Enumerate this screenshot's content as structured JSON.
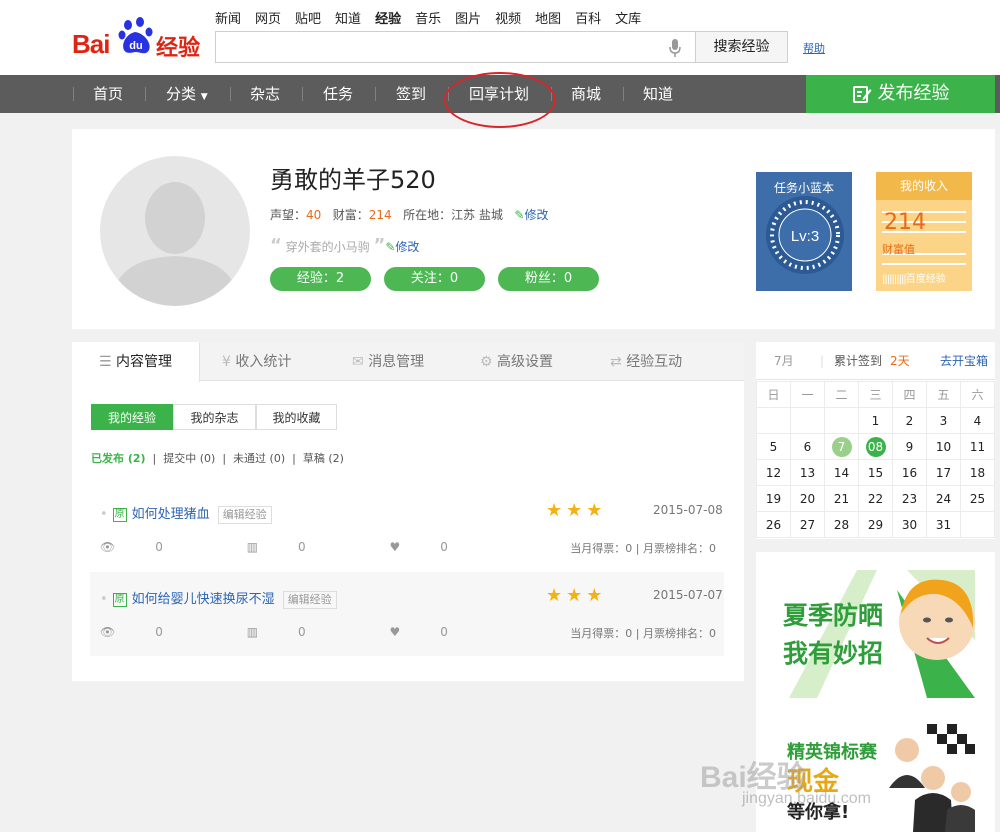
{
  "header": {
    "logo_text": "Bai",
    "logo_du": "du",
    "logo_jy": "经验",
    "top_nav": [
      "新闻",
      "网页",
      "贴吧",
      "知道",
      "经验",
      "音乐",
      "图片",
      "视频",
      "地图",
      "百科",
      "文库"
    ],
    "active_top_nav": "经验",
    "search_placeholder": "",
    "search_button": "搜索经验",
    "help": "帮助"
  },
  "navbar": {
    "items": [
      "首页",
      "分类",
      "杂志",
      "任务",
      "签到",
      "回享计划",
      "商城",
      "知道"
    ],
    "publish": "发布经验"
  },
  "profile": {
    "name": "勇敢的羊子520",
    "reputation_label": "声望：",
    "reputation": "40",
    "wealth_label": "财富：",
    "wealth": "214",
    "location_label": "所在地：",
    "location": "江苏 盐城",
    "edit": "修改",
    "motto": "穿外套的小马驹",
    "stats": [
      "经验：2",
      "关注：0",
      "粉丝：0"
    ]
  },
  "task_card": {
    "title": "任务小蓝本",
    "level": "Lv:3"
  },
  "income_card": {
    "title": "我的收入",
    "amount": "214",
    "unit": "财富值",
    "brand": "百度经验"
  },
  "tabs": [
    "内容管理",
    "收入统计",
    "消息管理",
    "高级设置",
    "经验互动"
  ],
  "sub_tabs": [
    "我的经验",
    "我的杂志",
    "我的收藏"
  ],
  "filters": {
    "published": "已发布",
    "published_count": "(2)",
    "submitting": "提交中 (0)",
    "rejected": "未通过 (0)",
    "drafts": "草稿 (2)"
  },
  "experiences": [
    {
      "badge": "原",
      "title": "如何处理猪血",
      "edit": "编辑经验",
      "stars": 3,
      "date": "2015-07-08",
      "views": "0",
      "votes_count": "0",
      "likes": "0",
      "votes": "当月得票：0 | 月票榜排名：0"
    },
    {
      "badge": "原",
      "title": "如何给婴儿快速换尿不湿",
      "edit": "编辑经验",
      "stars": 3,
      "date": "2015-07-07",
      "views": "0",
      "votes_count": "0",
      "likes": "0",
      "votes": "当月得票：0 | 月票榜排名：0"
    }
  ],
  "calendar": {
    "month": "7月",
    "streak_label": "累计签到",
    "streak": "2天",
    "link": "去开宝箱",
    "weekdays": [
      "日",
      "一",
      "二",
      "三",
      "四",
      "五",
      "六"
    ],
    "weeks": [
      [
        "",
        "",
        "",
        "1",
        "2",
        "3",
        "4"
      ],
      [
        "5",
        "6",
        "7",
        "08",
        "9",
        "10",
        "11"
      ],
      [
        "12",
        "13",
        "14",
        "15",
        "16",
        "17",
        "18"
      ],
      [
        "19",
        "20",
        "21",
        "22",
        "23",
        "24",
        "25"
      ],
      [
        "26",
        "27",
        "28",
        "29",
        "30",
        "31",
        ""
      ]
    ],
    "signed_days": [
      "7",
      "08"
    ]
  },
  "ads": {
    "ad1_line1": "夏季防晒",
    "ad1_line2": "我有妙招",
    "ad2_line1": "精英锦标赛",
    "ad2_line2": "现金",
    "ad2_line3": "等你拿!"
  },
  "watermark": {
    "main": "Bai经验",
    "sub": "jingyan.baidu.com"
  },
  "colors": {
    "brand_red": "#de2514",
    "green": "#3cb34a",
    "nav_gray": "#5c5c5c",
    "link_blue": "#2d64b3",
    "orange": "#e86a18"
  }
}
